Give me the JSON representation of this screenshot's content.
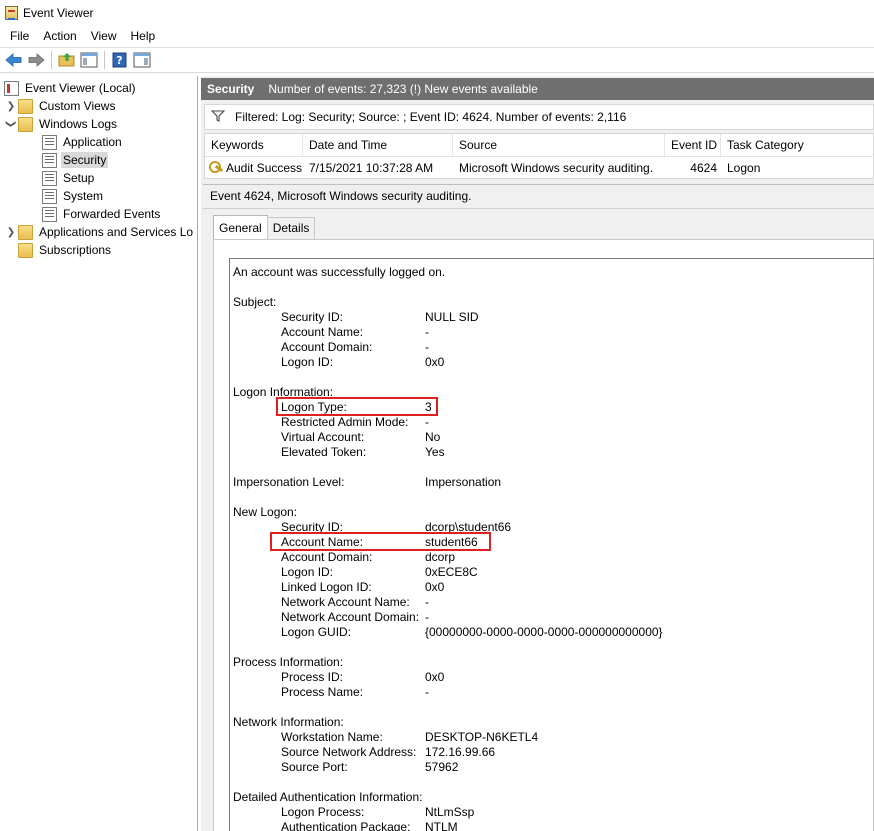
{
  "window": {
    "title": "Event Viewer"
  },
  "menu": [
    "File",
    "Action",
    "View",
    "Help"
  ],
  "toolbar": {
    "buttons": [
      "back-arrow-icon",
      "forward-arrow-icon",
      "up-folder-icon",
      "show-hide-tree-icon",
      "help-icon",
      "show-hide-action-pane-icon"
    ]
  },
  "tree": {
    "items": [
      {
        "label": "Event Viewer (Local)",
        "icon": "event-viewer-icon",
        "expander": "",
        "level": 0
      },
      {
        "label": "Custom Views",
        "icon": "folder-icon",
        "expander": "collapsed",
        "level": 1
      },
      {
        "label": "Windows Logs",
        "icon": "folder-icon",
        "expander": "expanded",
        "level": 1
      },
      {
        "label": "Application",
        "icon": "log-icon",
        "expander": "",
        "level": 2
      },
      {
        "label": "Security",
        "icon": "log-icon",
        "expander": "",
        "level": 2,
        "selected": true
      },
      {
        "label": "Setup",
        "icon": "log-icon",
        "expander": "",
        "level": 2
      },
      {
        "label": "System",
        "icon": "log-icon",
        "expander": "",
        "level": 2
      },
      {
        "label": "Forwarded Events",
        "icon": "log-icon",
        "expander": "",
        "level": 2
      },
      {
        "label": "Applications and Services Lo",
        "icon": "folder-icon",
        "expander": "collapsed",
        "level": 1
      },
      {
        "label": "Subscriptions",
        "icon": "folder-icon",
        "expander": "",
        "level": 1
      }
    ]
  },
  "log_header": {
    "name": "Security",
    "info": "Number of events: 27,323 (!) New events available"
  },
  "filter": {
    "text": "Filtered: Log: Security; Source: ; Event ID: 4624. Number of events: 2,116"
  },
  "grid": {
    "columns": [
      "Keywords",
      "Date and Time",
      "Source",
      "Event ID",
      "Task Category"
    ],
    "rows": [
      {
        "keywords": "Audit Success",
        "date": "7/15/2021 10:37:28 AM",
        "source": "Microsoft Windows security auditing.",
        "event_id": "4624",
        "category": "Logon"
      }
    ]
  },
  "detail": {
    "title": "Event 4624, Microsoft Windows security auditing.",
    "tabs": [
      "General",
      "Details"
    ],
    "active_tab": "General",
    "message": [
      {
        "k": "An account was successfully logged on.",
        "v": ""
      },
      {
        "k": "",
        "v": ""
      },
      {
        "k": "Subject:",
        "v": ""
      },
      {
        "k": "Security ID:",
        "v": "NULL SID",
        "indent": true
      },
      {
        "k": "Account Name:",
        "v": "-",
        "indent": true
      },
      {
        "k": "Account Domain:",
        "v": "-",
        "indent": true
      },
      {
        "k": "Logon ID:",
        "v": "0x0",
        "indent": true
      },
      {
        "k": "",
        "v": ""
      },
      {
        "k": "Logon Information:",
        "v": ""
      },
      {
        "k": "Logon Type:",
        "v": "3",
        "indent": true,
        "highlight": true
      },
      {
        "k": "Restricted Admin Mode:",
        "v": "-",
        "indent": true
      },
      {
        "k": "Virtual Account:",
        "v": "No",
        "indent": true
      },
      {
        "k": "Elevated Token:",
        "v": "Yes",
        "indent": true
      },
      {
        "k": "",
        "v": ""
      },
      {
        "k": "Impersonation Level:",
        "v": "Impersonation"
      },
      {
        "k": "",
        "v": ""
      },
      {
        "k": "New Logon:",
        "v": ""
      },
      {
        "k": "Security ID:",
        "v": "dcorp\\student66",
        "indent": true
      },
      {
        "k": "Account Name:",
        "v": "student66",
        "indent": true,
        "highlight": true
      },
      {
        "k": "Account Domain:",
        "v": "dcorp",
        "indent": true
      },
      {
        "k": "Logon ID:",
        "v": "0xECE8C",
        "indent": true
      },
      {
        "k": "Linked Logon ID:",
        "v": "0x0",
        "indent": true
      },
      {
        "k": "Network Account Name:",
        "v": "-",
        "indent": true
      },
      {
        "k": "Network Account Domain:",
        "v": "-",
        "indent": true
      },
      {
        "k": "Logon GUID:",
        "v": "{00000000-0000-0000-0000-000000000000}",
        "indent": true
      },
      {
        "k": "",
        "v": ""
      },
      {
        "k": "Process Information:",
        "v": ""
      },
      {
        "k": "Process ID:",
        "v": "0x0",
        "indent": true
      },
      {
        "k": "Process Name:",
        "v": "-",
        "indent": true
      },
      {
        "k": "",
        "v": ""
      },
      {
        "k": "Network Information:",
        "v": ""
      },
      {
        "k": "Workstation Name:",
        "v": "DESKTOP-N6KETL4",
        "indent": true
      },
      {
        "k": "Source Network Address:",
        "v": "172.16.99.66",
        "indent": true
      },
      {
        "k": "Source Port:",
        "v": "57962",
        "indent": true
      },
      {
        "k": "",
        "v": ""
      },
      {
        "k": "Detailed Authentication Information:",
        "v": ""
      },
      {
        "k": "Logon Process:",
        "v": "NtLmSsp",
        "indent": true
      },
      {
        "k": "Authentication Package:",
        "v": "NTLM",
        "indent": true
      }
    ]
  },
  "colors": {
    "header_bg": "#6f6f6f",
    "highlight_border": "#e02020",
    "selection_bg": "#d9d9d9"
  }
}
